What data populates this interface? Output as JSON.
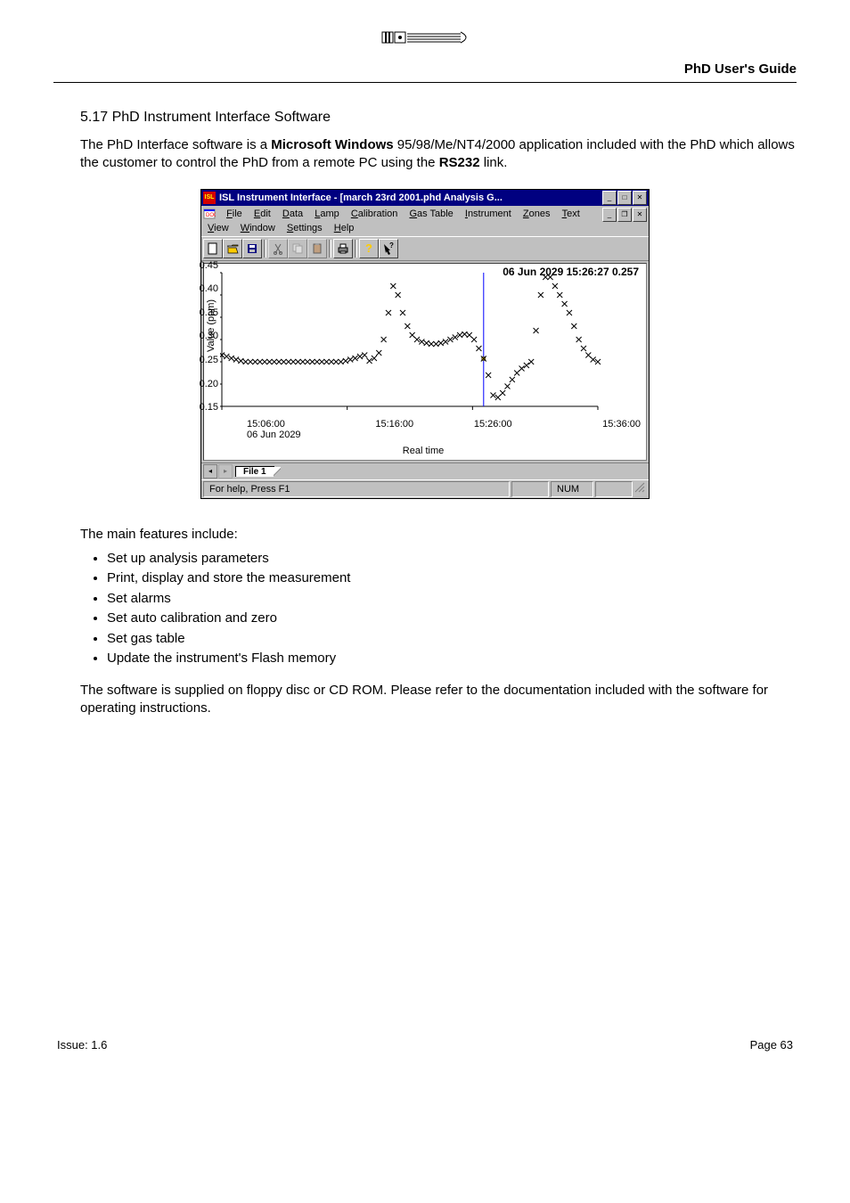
{
  "header": {
    "title": "PhD User's Guide"
  },
  "section": {
    "title": "5.17 PhD Instrument Interface Software"
  },
  "para1_pre": "The PhD Interface software is a ",
  "para1_bold1": "Microsoft Windows",
  "para1_mid": " 95/98/Me/NT4/2000 application included with the PhD which allows the customer to control the PhD from a remote PC using the ",
  "para1_bold2": "RS232",
  "para1_post": " link.",
  "window": {
    "title": "ISL Instrument Interface - [march 23rd 2001.phd  Analysis G...",
    "menus": [
      "File",
      "Edit",
      "Data",
      "Lamp",
      "Calibration",
      "Gas Table",
      "Instrument",
      "Zones",
      "Text",
      "View",
      "Window",
      "Settings",
      "Help"
    ],
    "cursor_readout": "06 Jun 2029 15:26:27 0.257",
    "tab": "File 1",
    "status": "For help, Press F1",
    "status_ind": "NUM"
  },
  "chart_data": {
    "type": "scatter",
    "title": "",
    "xlabel": "Real time",
    "ylabel": "Value (ppm)",
    "ylim": [
      0.15,
      0.45
    ],
    "yticks": [
      0.45,
      0.4,
      0.35,
      0.3,
      0.25,
      0.2,
      0.15
    ],
    "xticks": [
      "15:06:00",
      "15:16:00",
      "15:26:00",
      "15:36:00"
    ],
    "xdate": "06 Jun 2029",
    "cursor_x": "15:26:27",
    "cursor_y": 0.257,
    "x": [
      0,
      1,
      2,
      3,
      4,
      5,
      6,
      7,
      8,
      9,
      10,
      11,
      12,
      13,
      14,
      15,
      16,
      17,
      18,
      19,
      20,
      21,
      22,
      23,
      24,
      25,
      26,
      27,
      28,
      29,
      30,
      31,
      32,
      33,
      34,
      35,
      36,
      37,
      38,
      39,
      40,
      41,
      42,
      43,
      44,
      45,
      46,
      47,
      48,
      49,
      50,
      51,
      52,
      53,
      54,
      55,
      56,
      57,
      58,
      59,
      60,
      61,
      62,
      63,
      64,
      65,
      66,
      67,
      68,
      69,
      70,
      71,
      72,
      73,
      74,
      75,
      76,
      77,
      78,
      79
    ],
    "y": [
      0.265,
      0.262,
      0.258,
      0.255,
      0.252,
      0.25,
      0.25,
      0.25,
      0.25,
      0.25,
      0.25,
      0.25,
      0.25,
      0.25,
      0.25,
      0.25,
      0.25,
      0.25,
      0.25,
      0.25,
      0.25,
      0.25,
      0.25,
      0.25,
      0.25,
      0.25,
      0.252,
      0.255,
      0.258,
      0.262,
      0.265,
      0.252,
      0.258,
      0.27,
      0.3,
      0.36,
      0.42,
      0.4,
      0.36,
      0.33,
      0.31,
      0.3,
      0.295,
      0.292,
      0.29,
      0.29,
      0.292,
      0.295,
      0.3,
      0.305,
      0.31,
      0.312,
      0.31,
      0.3,
      0.28,
      0.257,
      0.22,
      0.175,
      0.17,
      0.18,
      0.195,
      0.21,
      0.225,
      0.235,
      0.242,
      0.25,
      0.32,
      0.4,
      0.44,
      0.44,
      0.42,
      0.4,
      0.38,
      0.36,
      0.33,
      0.3,
      0.28,
      0.265,
      0.255,
      0.25
    ]
  },
  "features_intro": "The main features include:",
  "features": [
    "Set up analysis parameters",
    "Print, display and store the measurement",
    "Set alarms",
    "Set auto calibration and zero",
    "Set gas table",
    "Update the instrument's Flash memory"
  ],
  "para2": "The software is supplied on floppy disc or CD ROM.  Please refer to the documentation included with the software for operating instructions.",
  "footer": {
    "left": "Issue: 1.6",
    "right": "Page 63"
  }
}
